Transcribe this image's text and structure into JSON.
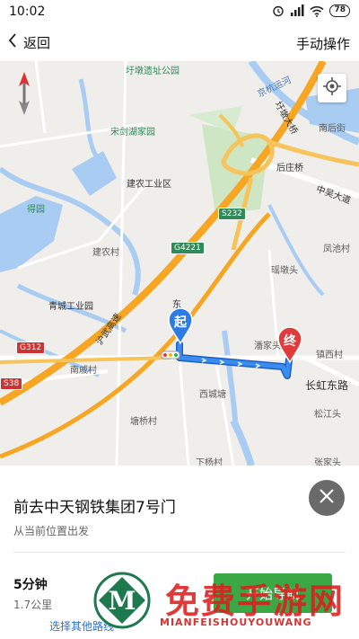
{
  "status_bar": {
    "time": "10:02",
    "battery": "78"
  },
  "header": {
    "back_label": "返回",
    "manual_label": "手动操作"
  },
  "map": {
    "labels": {
      "yudun_park": "圩墩遗址公园",
      "jinghang_canal": "京杭运河",
      "songjianhu": "宋剑湖家园",
      "jiannong": "建农工业区",
      "houzhuangqiao": "后庄桥",
      "zhongwu": "中吴大道",
      "nanhoujia": "南后街",
      "yudun_bridge": "圩墩大桥",
      "dejia": "得园",
      "jiannong_village": "建农村",
      "fengchi": "凤池村",
      "yaodun": "瑶墩头",
      "qingcheng": "青城工业园",
      "huwu": "沪武高速",
      "dong": "东",
      "nanwei": "南戚村",
      "panjia": "潘家头",
      "zhenxi": "镇西村",
      "changhong": "长虹东路",
      "songjiang": "松江头",
      "tangqiao": "塘桥村",
      "xicheng": "西城塘",
      "xiazhuang": "下杨村",
      "zhang": "张家头"
    },
    "shields": {
      "s232": "S232",
      "g4221": "G4221",
      "g312": "G312",
      "s38": "S38"
    },
    "start_pin": "起",
    "end_pin": "终"
  },
  "panel": {
    "destination": "前去中天钢铁集团7号门",
    "from": "从当前位置出发",
    "duration": "5分钟",
    "distance": "1.7公里",
    "other_routes": "选择其他路线",
    "start_nav": "开始导航"
  },
  "watermark": {
    "logo_letter": "M",
    "big": "免费手游网",
    "small": "MIANFEISHOUYOUWANG"
  },
  "colors": {
    "route": "#2d7be5",
    "start_pin": "#2d7be5",
    "end_pin": "#e03c3c",
    "start_button": "#3aa845",
    "highway": "#f6a623"
  }
}
